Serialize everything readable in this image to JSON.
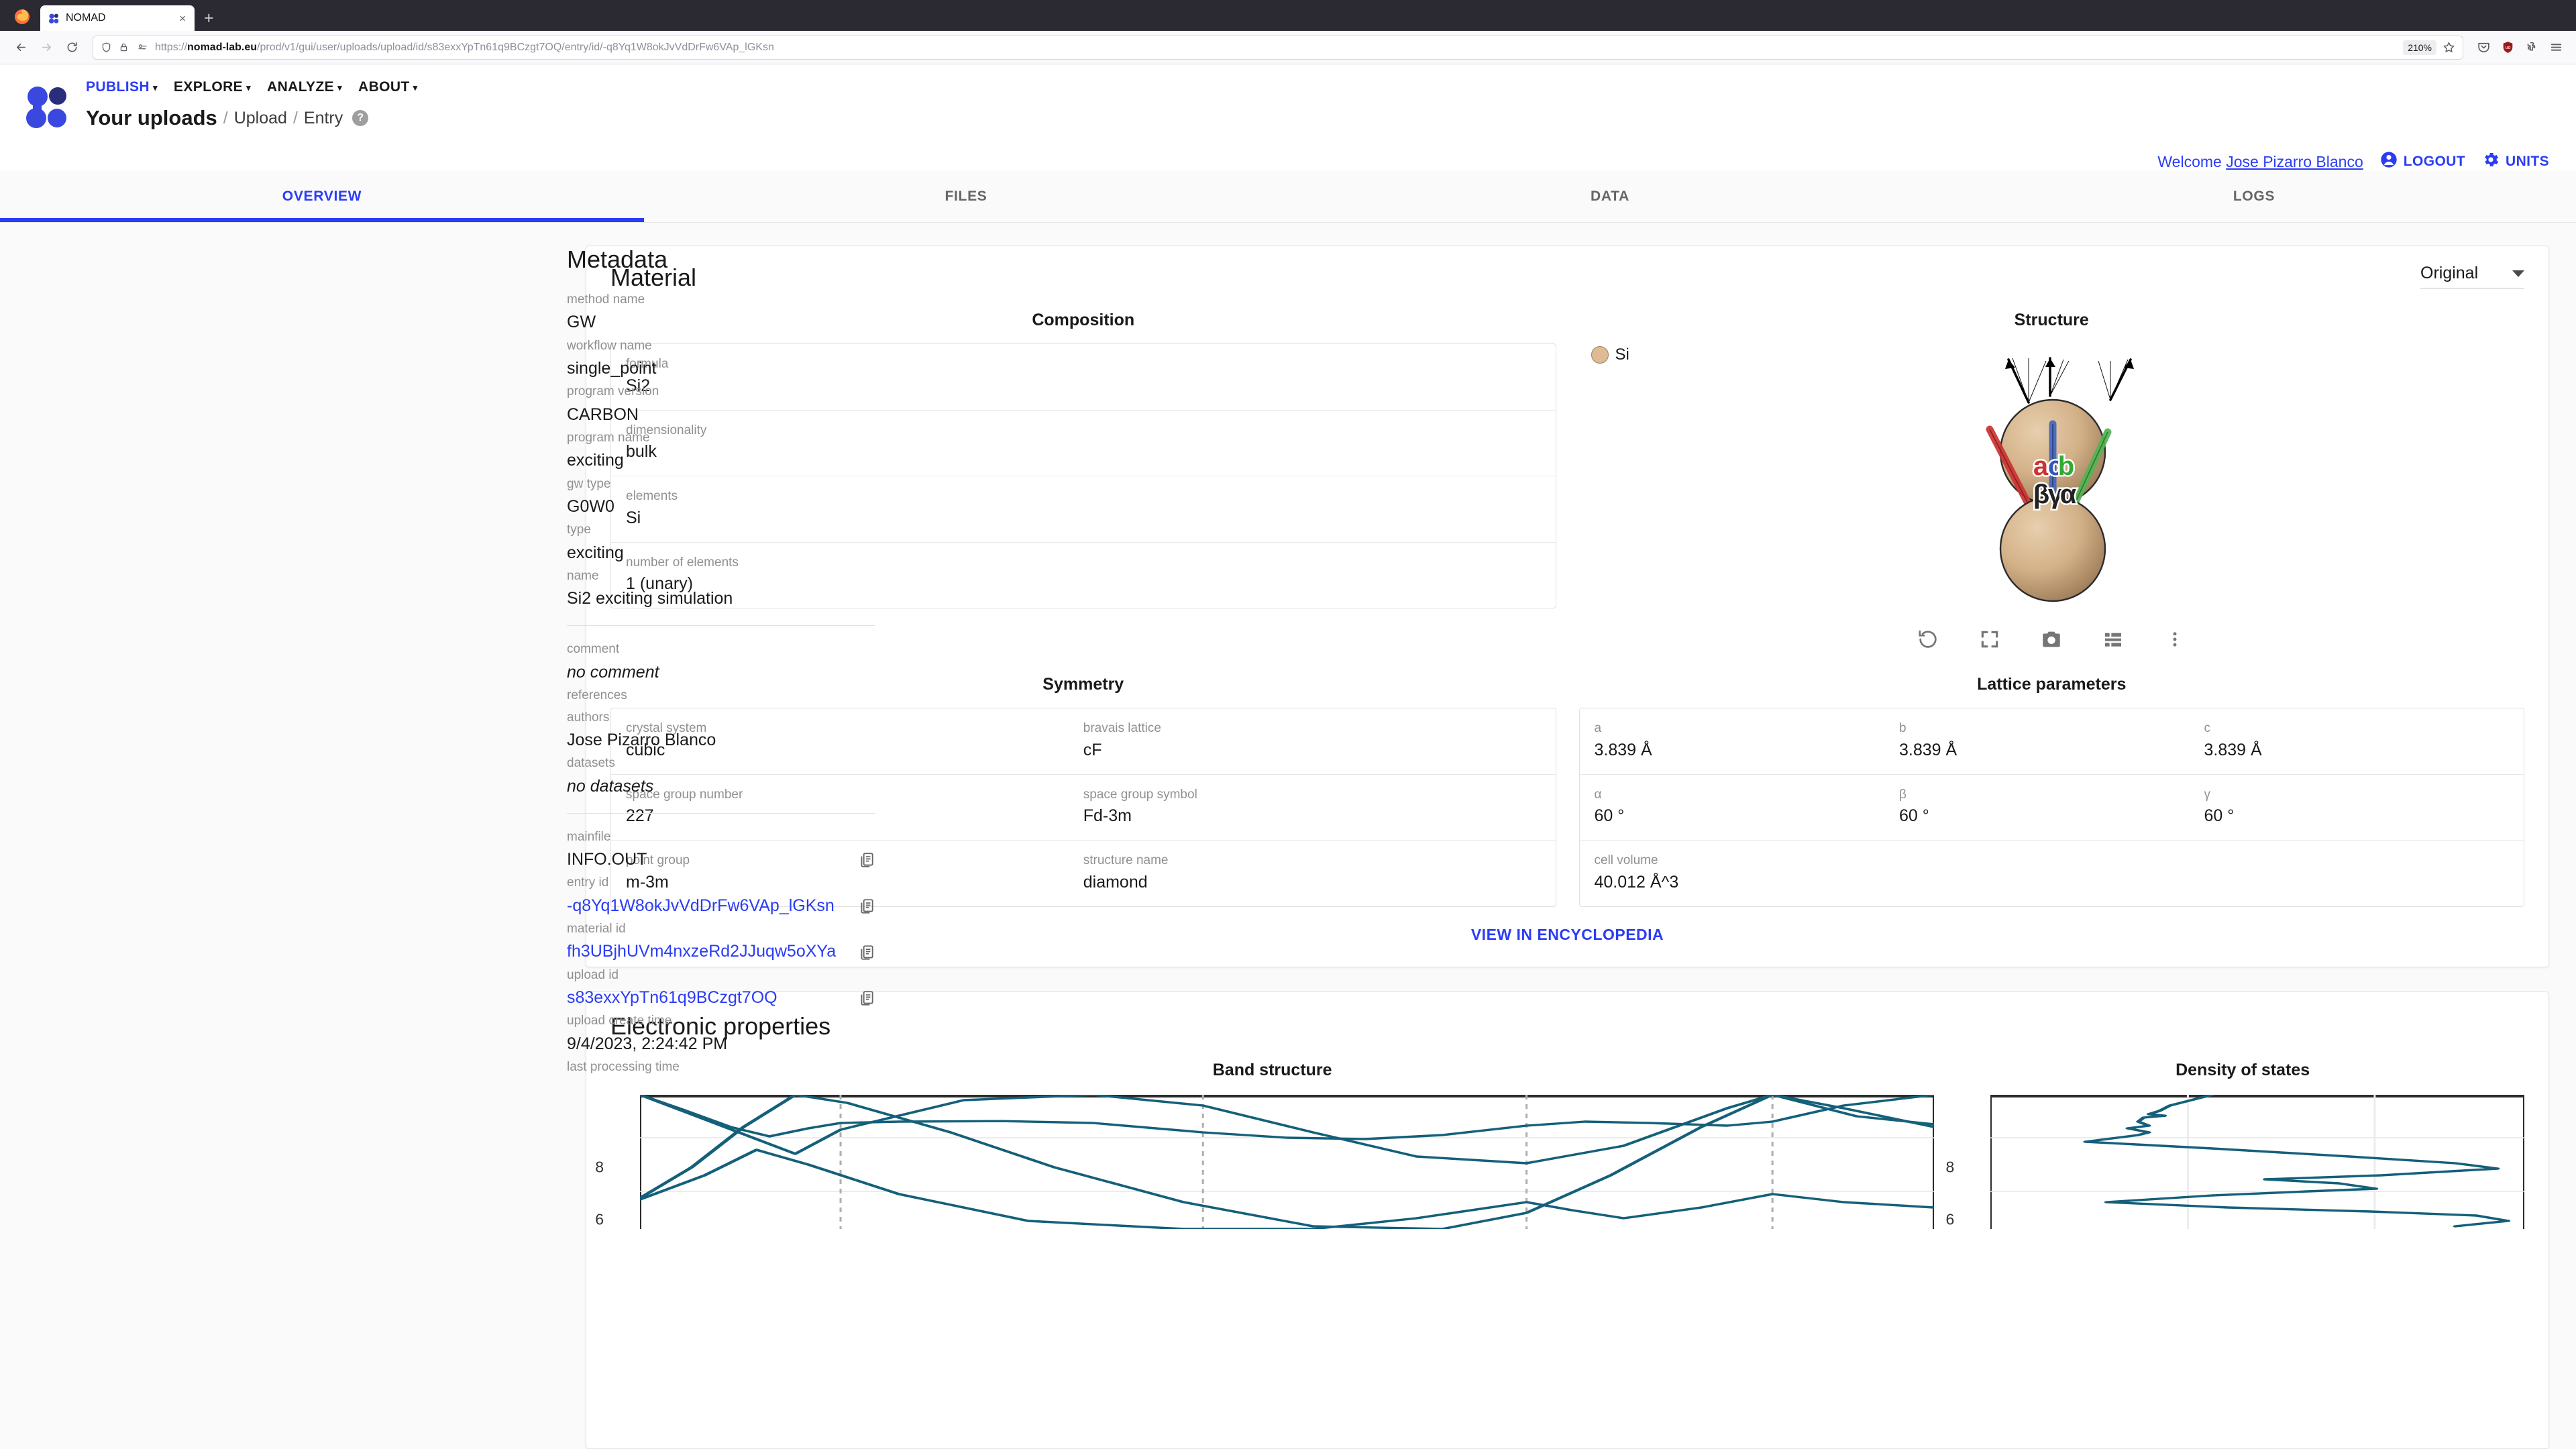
{
  "browser": {
    "tab_title": "NOMAD",
    "tab_favicon": "nomad-logo-icon",
    "new_tab": "+",
    "close": "×",
    "url_prefix": "https://",
    "url_domain": "nomad-lab.eu",
    "url_path": "/prod/v1/gui/user/uploads/upload/id/s83exxYpTn61q9BCzgt7OQ/entry/id/-q8Yq1W8okJvVdDrFw6VAp_lGKsn",
    "zoom_level": "210%"
  },
  "header": {
    "nav": [
      {
        "label": "PUBLISH",
        "active": true
      },
      {
        "label": "EXPLORE",
        "active": false
      },
      {
        "label": "ANALYZE",
        "active": false
      },
      {
        "label": "ABOUT",
        "active": false
      }
    ],
    "breadcrumb_current": "Your uploads",
    "breadcrumb_items": [
      "Upload",
      "Entry"
    ],
    "separator": "/",
    "help": "?",
    "welcome_prefix": "Welcome ",
    "welcome_user": "Jose Pizarro Blanco",
    "logout": "LOGOUT",
    "units": "UNITS",
    "accent_color": "#2a3cf5"
  },
  "entry_tabs": [
    {
      "label": "OVERVIEW",
      "active": true
    },
    {
      "label": "FILES",
      "active": false
    },
    {
      "label": "DATA",
      "active": false
    },
    {
      "label": "LOGS",
      "active": false
    }
  ],
  "metadata": {
    "title": "Metadata",
    "fields": [
      {
        "label": "method name",
        "value": "GW"
      },
      {
        "label": "workflow name",
        "value": "single_point"
      },
      {
        "label": "program version",
        "value": "CARBON"
      },
      {
        "label": "program name",
        "value": "exciting"
      },
      {
        "label": "gw type",
        "value": "G0W0"
      },
      {
        "label": "type",
        "value": "exciting"
      },
      {
        "label": "name",
        "value": "Si2 exciting simulation"
      }
    ],
    "fields2": [
      {
        "label": "comment",
        "value": "no comment",
        "italic": true
      },
      {
        "label": "references",
        "value": ""
      },
      {
        "label": "authors",
        "value": "Jose Pizarro Blanco"
      },
      {
        "label": "datasets",
        "value": "no datasets",
        "italic": true
      }
    ],
    "fields3": [
      {
        "label": "mainfile",
        "value": "INFO.OUT",
        "copy": true,
        "link": false
      },
      {
        "label": "entry id",
        "value": "-q8Yq1W8okJvVdDrFw6VAp_lGKsn",
        "copy": true,
        "link": true
      },
      {
        "label": "material id",
        "value": "fh3UBjhUVm4nxzeRd2JJuqw5oXYa",
        "copy": true,
        "link": true
      },
      {
        "label": "upload id",
        "value": "s83exxYpTn61q9BCzgt7OQ",
        "copy": true,
        "link": true
      },
      {
        "label": "upload create time",
        "value": "9/4/2023, 2:24:42 PM",
        "copy": false,
        "link": false
      },
      {
        "label": "last processing time",
        "value": "",
        "copy": false,
        "link": false
      }
    ]
  },
  "material": {
    "title": "Material",
    "view_selector": "Original",
    "composition": {
      "title": "Composition",
      "rows": [
        {
          "cells": [
            {
              "label": "formula",
              "value": "Si2"
            }
          ]
        },
        {
          "cells": [
            {
              "label": "dimensionality",
              "value": "bulk"
            }
          ]
        },
        {
          "cells": [
            {
              "label": "elements",
              "value": "Si"
            }
          ]
        },
        {
          "cells": [
            {
              "label": "number of elements",
              "value": "1 (unary)"
            }
          ]
        }
      ]
    },
    "structure": {
      "title": "Structure",
      "species_label": "Si",
      "species_color": "#debb92",
      "axis_labels": {
        "a": "a",
        "b": "b",
        "c": "c",
        "alpha": "α",
        "beta": "β",
        "gamma": "γ"
      },
      "axis_colors": {
        "a": "#cc3333",
        "b": "#33aa33",
        "c": "#3355bb"
      },
      "tools": [
        "reset-icon",
        "fullscreen-icon",
        "camera-icon",
        "list-icon",
        "more-vert-icon"
      ]
    },
    "symmetry": {
      "title": "Symmetry",
      "rows": [
        {
          "cells": [
            {
              "label": "crystal system",
              "value": "cubic"
            },
            {
              "label": "bravais lattice",
              "value": "cF"
            }
          ]
        },
        {
          "cells": [
            {
              "label": "space group number",
              "value": "227"
            },
            {
              "label": "space group symbol",
              "value": "Fd-3m"
            }
          ]
        },
        {
          "cells": [
            {
              "label": "point group",
              "value": "m-3m"
            },
            {
              "label": "structure name",
              "value": "diamond"
            }
          ]
        }
      ]
    },
    "lattice": {
      "title": "Lattice parameters",
      "rows": [
        {
          "cells": [
            {
              "label": "a",
              "value": "3.839 Å"
            },
            {
              "label": "b",
              "value": "3.839 Å"
            },
            {
              "label": "c",
              "value": "3.839 Å"
            }
          ]
        },
        {
          "cells": [
            {
              "label": "α",
              "value": "60 °"
            },
            {
              "label": "β",
              "value": "60 °"
            },
            {
              "label": "γ",
              "value": "60 °"
            }
          ]
        },
        {
          "cells": [
            {
              "label": "cell volume",
              "value": "40.012 Å^3"
            }
          ]
        }
      ]
    },
    "encyclopedia_link": "VIEW IN ENCYCLOPEDIA"
  },
  "electronic": {
    "title": "Electronic properties",
    "band_title": "Band structure",
    "dos_title": "Density of states"
  },
  "chart_data": [
    {
      "type": "line",
      "title": "Band structure",
      "xlabel": "",
      "ylabel": "",
      "ytick_labels": [
        "8",
        "6"
      ],
      "ytick_values": [
        8,
        6
      ],
      "ylim": [
        4.6,
        9.6
      ],
      "grid": true,
      "line_color": "#14607a",
      "vertical_gridlines": [
        0.155,
        0.435,
        0.685,
        0.875
      ],
      "series": [
        {
          "name": "band-1",
          "x": [
            0,
            0.03,
            0.07,
            0.1,
            0.13,
            0.155,
            0.2,
            0.28,
            0.35,
            0.435,
            0.5,
            0.56,
            0.62,
            0.685,
            0.73,
            0.78,
            0.84,
            0.875,
            0.93,
            1.0
          ],
          "values": [
            9.6,
            9.1,
            8.4,
            8.05,
            8.35,
            8.55,
            8.6,
            8.62,
            8.55,
            8.2,
            8.0,
            7.95,
            8.1,
            8.45,
            8.6,
            8.55,
            8.45,
            8.6,
            9.2,
            9.6
          ]
        },
        {
          "name": "band-2",
          "x": [
            0,
            0.05,
            0.09,
            0.13,
            0.2,
            0.3,
            0.42,
            0.52,
            0.6,
            0.685,
            0.72,
            0.76,
            0.82,
            0.875,
            0.93,
            1.0
          ],
          "values": [
            5.7,
            6.6,
            7.55,
            7.0,
            5.9,
            4.9,
            4.6,
            4.6,
            5.0,
            5.6,
            5.3,
            5.0,
            5.4,
            5.9,
            5.6,
            5.4
          ]
        },
        {
          "name": "band-3",
          "x": [
            0,
            0.04,
            0.08,
            0.12,
            0.16,
            0.24,
            0.32,
            0.42,
            0.52,
            0.62,
            0.685,
            0.75,
            0.82,
            0.875,
            0.93,
            1.0
          ],
          "values": [
            5.75,
            6.9,
            8.4,
            9.6,
            9.3,
            8.2,
            6.9,
            5.6,
            4.7,
            4.6,
            5.2,
            6.6,
            8.4,
            9.6,
            9.1,
            8.4
          ]
        },
        {
          "name": "band-4",
          "x": [
            0,
            0.06,
            0.12,
            0.155,
            0.25,
            0.35,
            0.435,
            0.52,
            0.6,
            0.685,
            0.76,
            0.84,
            0.875,
            0.94,
            1.0
          ],
          "values": [
            9.6,
            8.5,
            7.4,
            8.3,
            9.4,
            9.6,
            9.2,
            8.2,
            7.3,
            7.05,
            7.7,
            9.1,
            9.6,
            8.8,
            8.5
          ]
        }
      ]
    },
    {
      "type": "line",
      "title": "Density of states",
      "xlabel": "",
      "ylabel": "",
      "ytick_labels": [
        "8",
        "6"
      ],
      "ytick_values": [
        8,
        6
      ],
      "ylim": [
        4.6,
        9.6
      ],
      "grid": true,
      "line_color": "#14607a",
      "orientation": "horizontal",
      "vertical_gridlines": [
        0.37,
        0.72
      ],
      "series": [
        {
          "name": "dos",
          "y": [
            9.6,
            9.4,
            9.2,
            9.0,
            8.88,
            8.82,
            8.75,
            8.6,
            8.45,
            8.35,
            8.2,
            8.1,
            8.0,
            7.85,
            7.6,
            7.3,
            7.05,
            6.85,
            6.6,
            6.45,
            6.3,
            6.1,
            6.0,
            5.85,
            5.6,
            5.4,
            5.25,
            5.1,
            4.9,
            4.7
          ],
          "values": [
            0.42,
            0.38,
            0.34,
            0.32,
            0.3,
            0.33,
            0.29,
            0.28,
            0.3,
            0.26,
            0.3,
            0.28,
            0.24,
            0.18,
            0.42,
            0.68,
            0.88,
            0.96,
            0.74,
            0.52,
            0.66,
            0.73,
            0.6,
            0.42,
            0.22,
            0.45,
            0.72,
            0.92,
            0.98,
            0.88
          ]
        }
      ]
    }
  ]
}
